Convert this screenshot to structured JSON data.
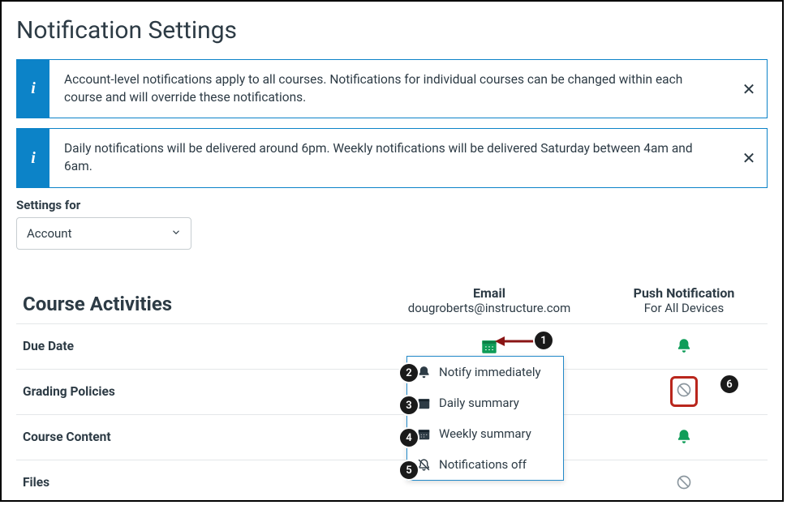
{
  "page": {
    "title": "Notification Settings"
  },
  "banners": [
    {
      "text": "Account-level notifications apply to all courses. Notifications for individual courses can be changed within each course and will override these notifications."
    },
    {
      "text": "Daily notifications will be delivered around 6pm. Weekly notifications will be delivered Saturday between 4am and 6am."
    }
  ],
  "settings_for": {
    "label": "Settings for",
    "value": "Account"
  },
  "columns": {
    "section_title": "Course Activities",
    "email_label": "Email",
    "email_sub": "dougroberts@instructure.com",
    "push_label": "Push Notification",
    "push_sub": "For All Devices"
  },
  "rows": [
    {
      "label": "Due Date"
    },
    {
      "label": "Grading Policies"
    },
    {
      "label": "Course Content"
    },
    {
      "label": "Files"
    }
  ],
  "dropdown": {
    "opt1": "Notify immediately",
    "opt2": "Daily summary",
    "opt3": "Weekly summary",
    "opt4": "Notifications off"
  },
  "markers": {
    "m1": "1",
    "m2": "2",
    "m3": "3",
    "m4": "4",
    "m5": "5",
    "m6": "6"
  }
}
